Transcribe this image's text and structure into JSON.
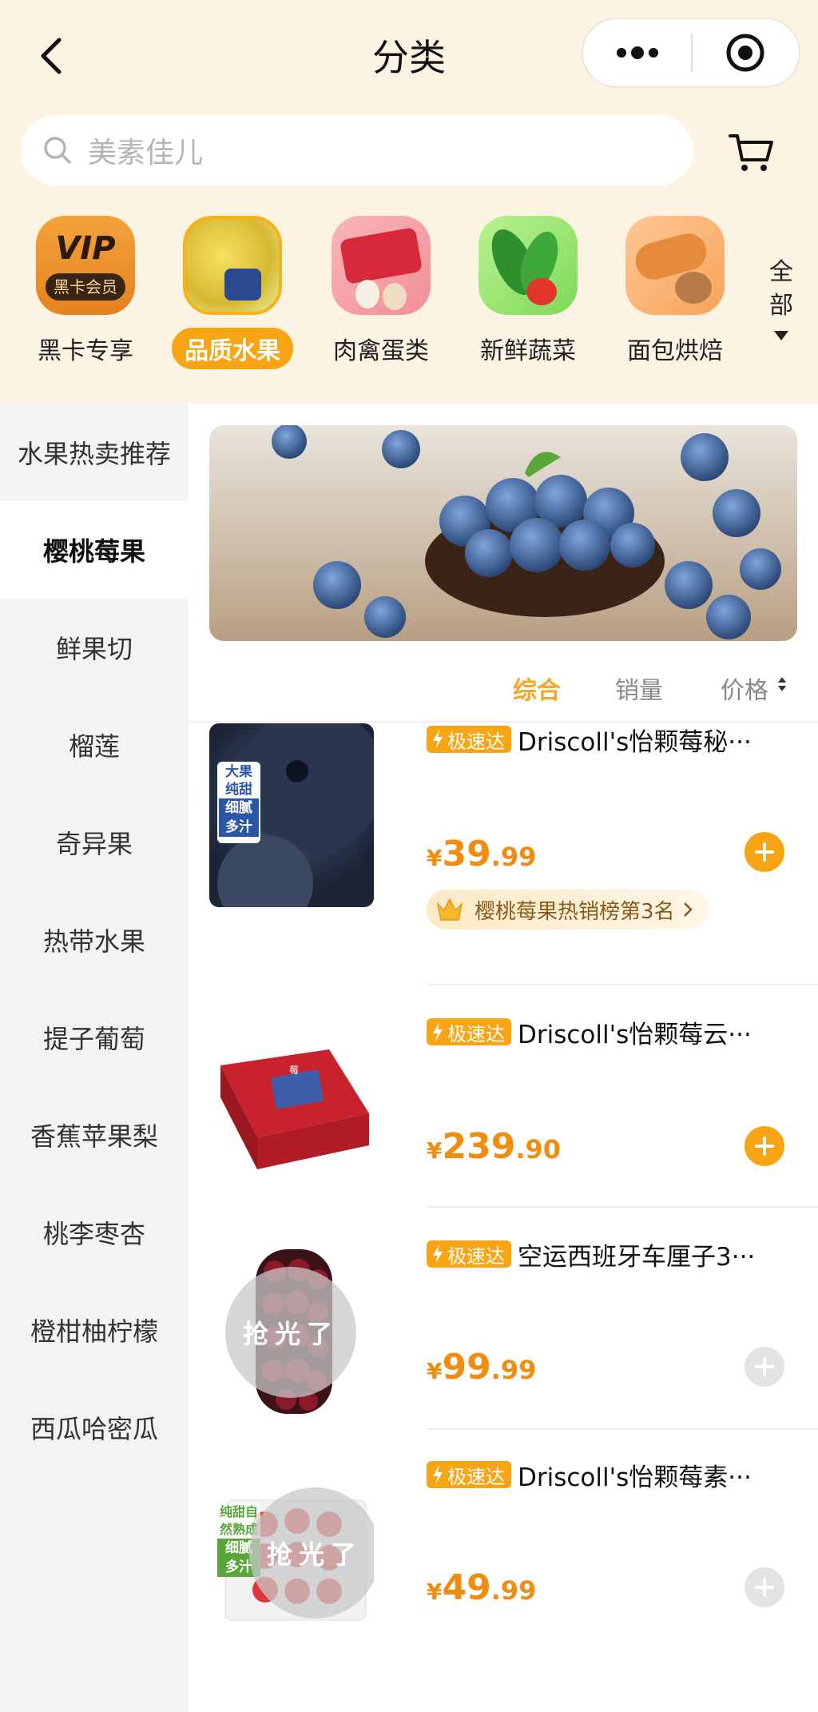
{
  "header": {
    "title": "分类"
  },
  "search": {
    "placeholder": "美素佳儿"
  },
  "categories": [
    {
      "label": "黑卡专享",
      "icon": "vip-card-icon",
      "vip_text": "VIP",
      "vip_sub": "黑卡会员",
      "active": false
    },
    {
      "label": "品质水果",
      "icon": "durian-fruit-icon",
      "active": true
    },
    {
      "label": "肉禽蛋类",
      "icon": "meat-egg-icon",
      "active": false
    },
    {
      "label": "新鲜蔬菜",
      "icon": "vegetable-icon",
      "active": false
    },
    {
      "label": "面包烘焙",
      "icon": "bread-icon",
      "active": false
    }
  ],
  "all_button": {
    "line1": "全",
    "line2": "部"
  },
  "sidebar": {
    "items": [
      {
        "label": "水果热卖推荐"
      },
      {
        "label": "樱桃莓果",
        "active": true
      },
      {
        "label": "鲜果切"
      },
      {
        "label": "榴莲"
      },
      {
        "label": "奇异果"
      },
      {
        "label": "热带水果"
      },
      {
        "label": "提子葡萄"
      },
      {
        "label": "香蕉苹果梨"
      },
      {
        "label": "桃李枣杏"
      },
      {
        "label": "橙柑柚柠檬"
      },
      {
        "label": "西瓜哈密瓜"
      }
    ]
  },
  "sort": {
    "overall": "综合",
    "sales": "销量",
    "price": "价格"
  },
  "express_tag": "极速达",
  "products": [
    {
      "name": "Driscoll's怡颗莓秘···",
      "price_currency": "¥",
      "price_int": "39",
      "price_dec": ".99",
      "badge_lines": [
        "大果",
        "纯甜",
        "细腻",
        "多汁"
      ],
      "rank_text": "樱桃莓果热销榜第3名",
      "available": true
    },
    {
      "name": "Driscoll's怡颗莓云···",
      "price_currency": "¥",
      "price_int": "239",
      "price_dec": ".90",
      "available": true
    },
    {
      "name": "空运西班牙车厘子3···",
      "price_currency": "¥",
      "price_int": "99",
      "price_dec": ".99",
      "sold_out_text": "抢光了",
      "available": false
    },
    {
      "name": "Driscoll's怡颗莓素···",
      "price_currency": "¥",
      "price_int": "49",
      "price_dec": ".99",
      "badge_lines": [
        "纯甜自",
        "然熟成",
        "细腻",
        "多汁"
      ],
      "sold_out_text": "抢光了",
      "available": false
    }
  ],
  "colors": {
    "accent": "#f7a514",
    "price": "#f28c0f",
    "header_bg": "#fdf3e3"
  }
}
